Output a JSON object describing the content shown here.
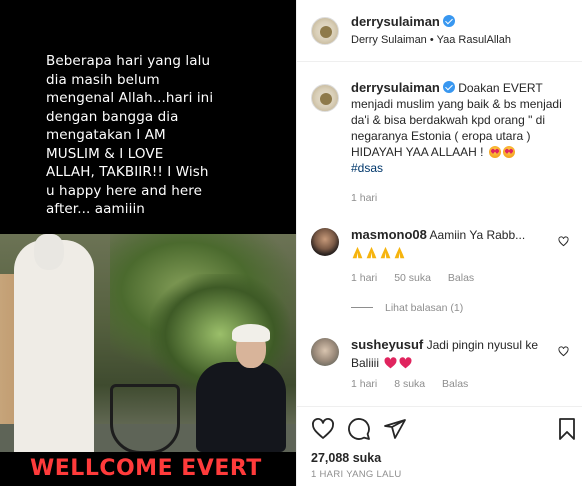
{
  "media": {
    "overlay_text": "Beberapa hari yang lalu\ndia masih belum\nmengenal Allah...hari ini\ndengan bangga dia\nmengatakan I AM\nMUSLIM & I LOVE\nALLAH, TAKBIIR!! I Wish\nu happy here and here\nafter... aamiiin",
    "banner_text": "WELLCOME EVERT"
  },
  "header": {
    "username": "derrysulaiman",
    "subtitle": "Derry Sulaiman • Yaa RasulAllah"
  },
  "caption": {
    "username": "derrysulaiman",
    "text": "Doakan EVERT menjadi muslim yang baik & bs menjadi da'i & bisa berdakwah kpd orang \" di negaranya Estonia ( eropa utara ) HIDAYAH YAA ALLAAH !",
    "hashtag": "#dsas",
    "time": "1 hari"
  },
  "comments": [
    {
      "username": "masmono08",
      "text": "Aamiin Ya Rabb...",
      "time": "1 hari",
      "likes": "50 suka",
      "reply_label": "Balas",
      "view_replies": "Lihat balasan (1)"
    },
    {
      "username": "susheyusuf",
      "text": "Jadi pingin nyusul ke Baliiii",
      "time": "1 hari",
      "likes": "8 suka",
      "reply_label": "Balas"
    }
  ],
  "footer": {
    "likes": "27,088 suka",
    "date": "1 HARI YANG LALU"
  },
  "colors": {
    "verified": "#3897f0",
    "banner_text": "#ff3b3b",
    "hashtag": "#00376b",
    "muted": "#8e8e8e"
  }
}
